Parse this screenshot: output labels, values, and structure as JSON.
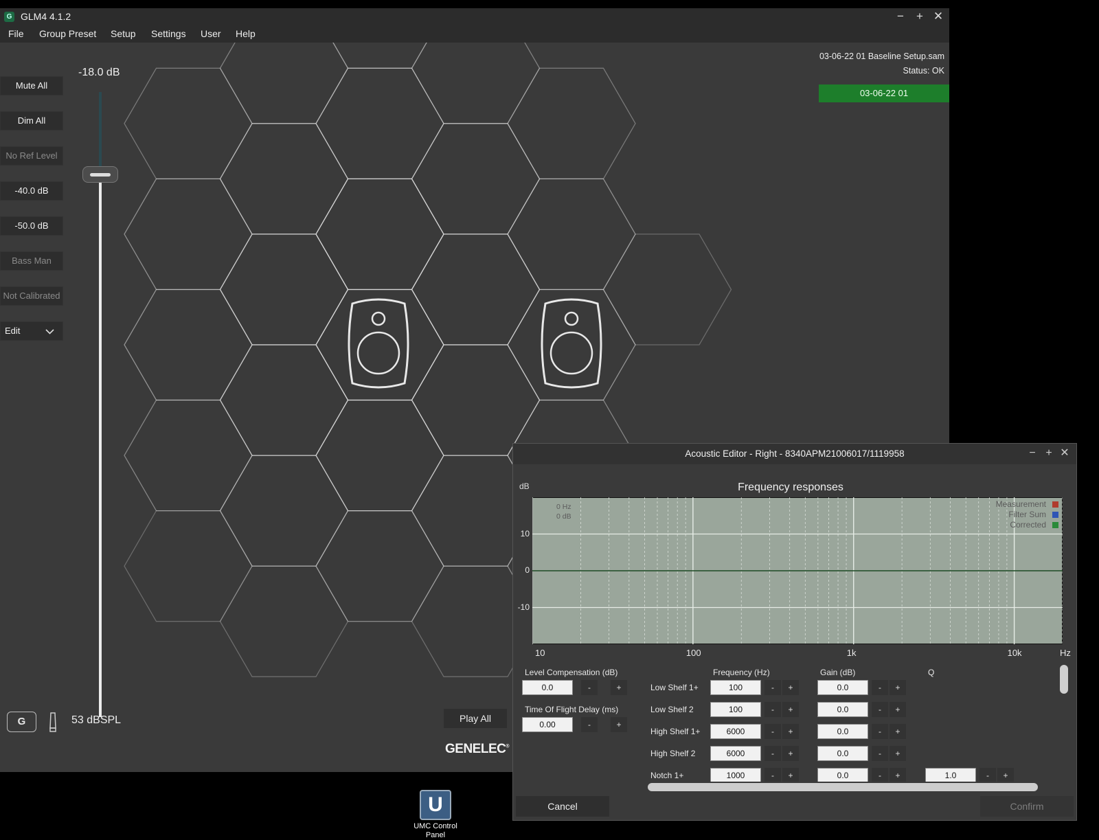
{
  "app": {
    "icon_letter": "G",
    "title": "GLM4  4.1.2",
    "menu": [
      "File",
      "Group Preset",
      "Setup",
      "Settings",
      "User",
      "Help"
    ]
  },
  "sidebar": {
    "buttons": [
      {
        "label": "Mute All",
        "enabled": true
      },
      {
        "label": "Dim All",
        "enabled": true
      },
      {
        "label": "No Ref Level",
        "enabled": false
      },
      {
        "label": "-40.0 dB",
        "enabled": true
      },
      {
        "label": "-50.0 dB",
        "enabled": true
      },
      {
        "label": "Bass Man",
        "enabled": false
      },
      {
        "label": "Not Calibrated",
        "enabled": false
      }
    ],
    "edit_select": "Edit"
  },
  "fader": {
    "value_label": "-18.0 dB",
    "level_fraction": 0.85
  },
  "status": {
    "preset_file": "03-06-22 01 Baseline Setup.sam",
    "status_text": "Status: OK",
    "group_name": "03-06-22 01",
    "group_color": "#1d7e2b"
  },
  "bottom_bar": {
    "g_button": "G",
    "spl": "53 dBSPL",
    "play_all": "Play All",
    "brand": "GENELEC",
    "brand_mark": "®"
  },
  "editor": {
    "title": "Acoustic Editor - Right - 8340APM21006017/1119958",
    "chart_title": "Frequency responses",
    "cursor_hz": "0 Hz",
    "cursor_db": "0 dB",
    "level_comp_label": "Level Compensation (dB)",
    "level_comp_value": "0.0",
    "tof_label": "Time Of Flight Delay (ms)",
    "tof_value": "0.00",
    "col_frequency": "Frequency (Hz)",
    "col_gain": "Gain (dB)",
    "col_q": "Q",
    "minus": "-",
    "plus": "+",
    "filters": [
      {
        "name": "Low Shelf 1+",
        "freq": "100",
        "gain": "0.0",
        "q": ""
      },
      {
        "name": "Low Shelf 2",
        "freq": "100",
        "gain": "0.0",
        "q": ""
      },
      {
        "name": "High Shelf 1+",
        "freq": "6000",
        "gain": "0.0",
        "q": ""
      },
      {
        "name": "High Shelf 2",
        "freq": "6000",
        "gain": "0.0",
        "q": ""
      },
      {
        "name": "Notch 1+",
        "freq": "1000",
        "gain": "0.0",
        "q": "1.0"
      }
    ],
    "cancel": "Cancel",
    "confirm": "Confirm"
  },
  "chart_data": {
    "type": "line",
    "title": "Frequency responses",
    "xlabel": "Hz",
    "ylabel": "dB",
    "x_scale": "log",
    "xlim": [
      10,
      20000
    ],
    "ylim": [
      -20,
      20
    ],
    "x_ticks": [
      "10",
      "100",
      "1k",
      "10k"
    ],
    "y_ticks": [
      "10",
      "0",
      "-10"
    ],
    "grid": true,
    "legend_position": "top-right",
    "series": [
      {
        "name": "Measurement",
        "color": "#b03a2e",
        "x": [],
        "y": []
      },
      {
        "name": "Filter Sum",
        "color": "#2f55b5",
        "x": [],
        "y": []
      },
      {
        "name": "Corrected",
        "color": "#2a8a3a",
        "x": [
          10,
          20000
        ],
        "y": [
          0,
          0
        ]
      }
    ]
  },
  "desktop": {
    "icon_letter": "U",
    "label": "UMC Control Panel"
  }
}
